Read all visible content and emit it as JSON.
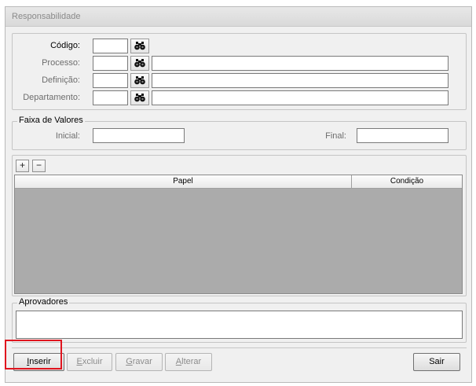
{
  "window": {
    "title": "Responsabilidade"
  },
  "filters": {
    "codigo": {
      "label": "Código:",
      "value": ""
    },
    "processo": {
      "label": "Processo:",
      "code": "",
      "description": ""
    },
    "definicao": {
      "label": "Definição:",
      "code": "",
      "description": ""
    },
    "departamento": {
      "label": "Departamento:",
      "code": "",
      "description": ""
    },
    "search_icon": "binoculars-icon"
  },
  "faixa": {
    "title": "Faixa de Valores",
    "inicial_label": "Inicial:",
    "inicial_value": "",
    "final_label": "Final:",
    "final_value": ""
  },
  "grid": {
    "add_label": "+",
    "remove_label": "−",
    "columns": [
      "Papel",
      "Condição"
    ],
    "rows": []
  },
  "aprovadores": {
    "title": "Aprovadores",
    "value": ""
  },
  "footer": {
    "inserir": {
      "pre": "",
      "u": "I",
      "post": "nserir"
    },
    "excluir": {
      "pre": "",
      "u": "E",
      "post": "xcluir"
    },
    "gravar": {
      "pre": "",
      "u": "G",
      "post": "ravar"
    },
    "alterar": {
      "pre": "",
      "u": "A",
      "post": "lterar"
    },
    "sair": "Sair"
  },
  "colors": {
    "highlight": "#e0141e",
    "grid_bg": "#ababab"
  }
}
